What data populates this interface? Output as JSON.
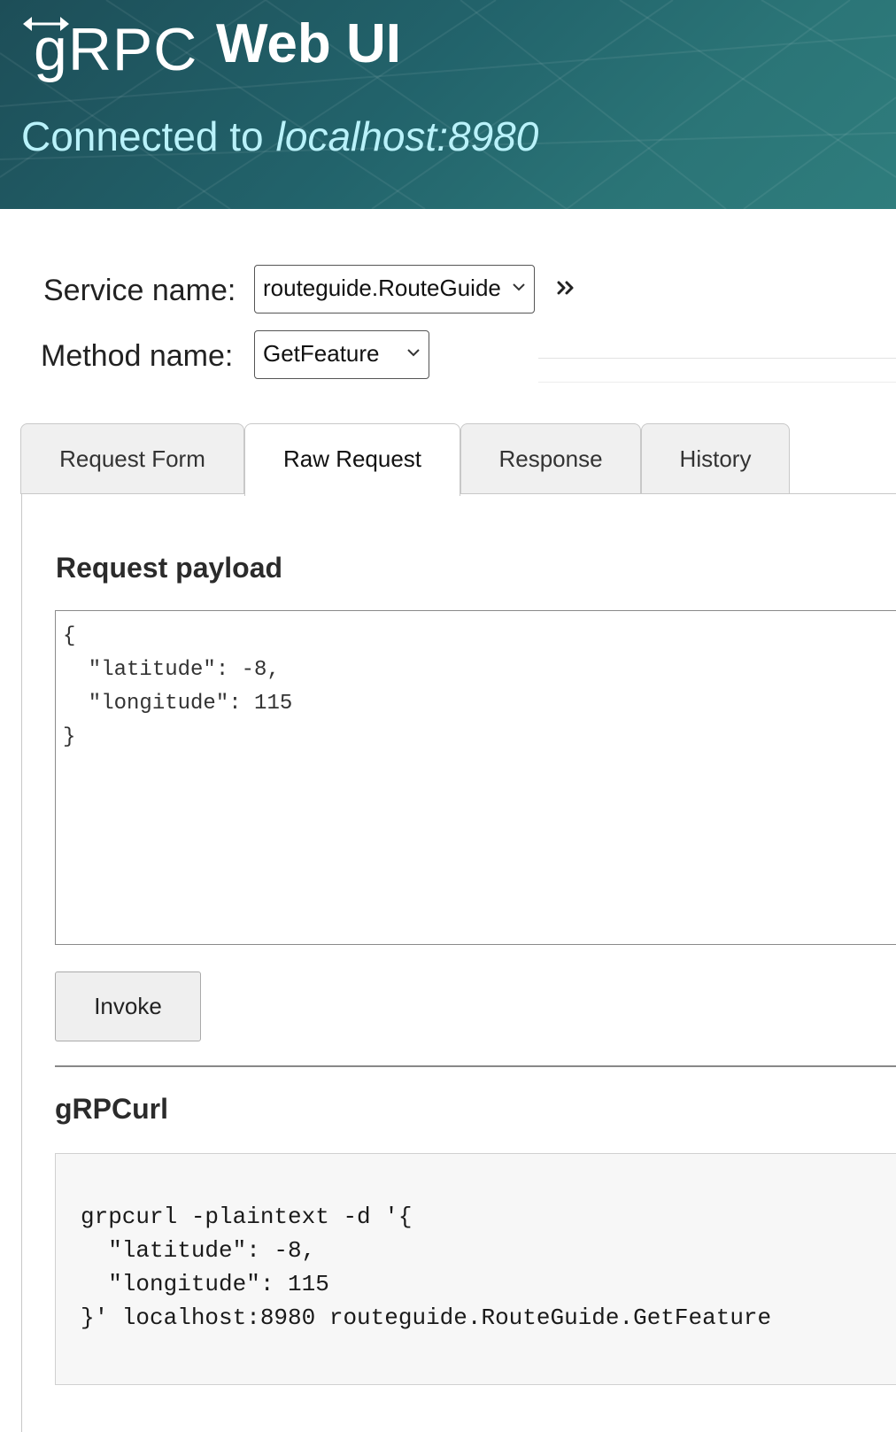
{
  "header": {
    "logo_text": "gRPC",
    "app_title": "Web UI",
    "connected_prefix": "Connected to",
    "host": "localhost:8980"
  },
  "selectors": {
    "service_label": "Service name:",
    "service_value": "routeguide.RouteGuide",
    "method_label": "Method name:",
    "method_value": "GetFeature"
  },
  "tabs": [
    {
      "label": "Request Form",
      "active": false
    },
    {
      "label": "Raw Request",
      "active": true
    },
    {
      "label": "Response",
      "active": false
    },
    {
      "label": "History",
      "active": false
    }
  ],
  "payload": {
    "title": "Request payload",
    "text": "{\n  \"latitude\": -8,\n  \"longitude\": 115\n}"
  },
  "invoke": {
    "label": "Invoke"
  },
  "grpcurl": {
    "title": "gRPCurl",
    "command": "grpcurl -plaintext -d '{\n  \"latitude\": -8,\n  \"longitude\": 115\n}' localhost:8980 routeguide.RouteGuide.GetFeature"
  },
  "colors": {
    "header_bg": "#22636b",
    "connected_text": "#b9f2fa"
  }
}
